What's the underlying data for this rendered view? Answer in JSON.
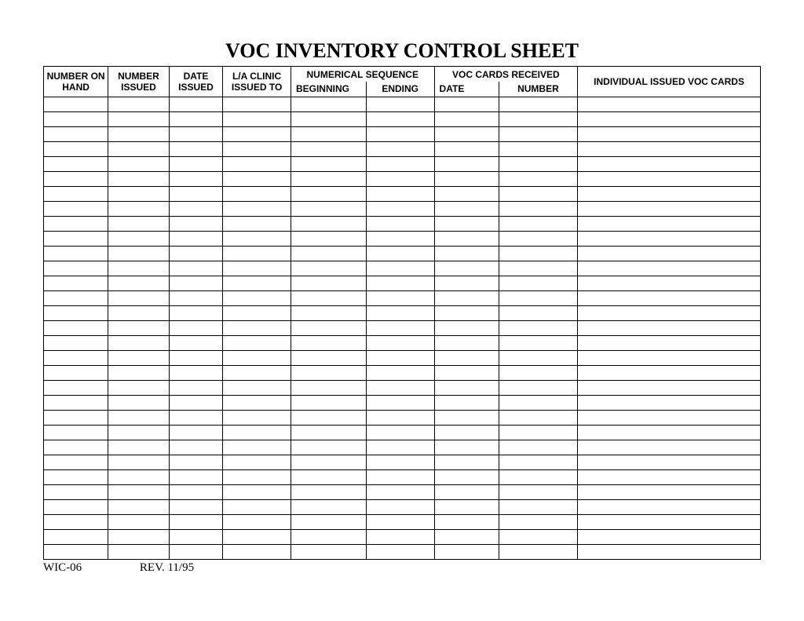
{
  "title": "VOC INVENTORY CONTROL SHEET",
  "headers": {
    "number_on_hand": "NUMBER ON HAND",
    "number_issued": "NUMBER ISSUED",
    "date_issued": "DATE ISSUED",
    "la_clinic_issued_to": "L/A CLINIC ISSUED TO",
    "numerical_sequence": "NUMERICAL SEQUENCE",
    "numerical_sequence_beginning": "BEGINNING",
    "numerical_sequence_ending": "ENDING",
    "voc_cards_received": "VOC CARDS RECEIVED",
    "voc_cards_received_date": "DATE",
    "voc_cards_received_number": "NUMBER",
    "individual_issued_voc_cards": "INDIVIDUAL ISSUED VOC CARDS"
  },
  "row_count": 31,
  "footer": {
    "form_id": "WIC-06",
    "revision": "REV. 11/95"
  }
}
